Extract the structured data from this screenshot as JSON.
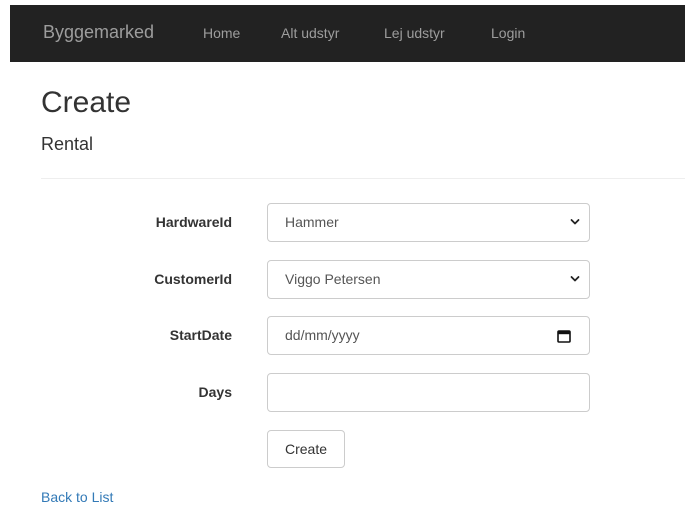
{
  "navbar": {
    "brand": "Byggemarked",
    "links": [
      {
        "label": "Home"
      },
      {
        "label": "Alt udstyr"
      },
      {
        "label": "Lej udstyr"
      },
      {
        "label": "Login"
      }
    ]
  },
  "page": {
    "title": "Create",
    "subtitle": "Rental"
  },
  "form": {
    "hardware": {
      "label": "HardwareId",
      "value": "Hammer"
    },
    "customer": {
      "label": "CustomerId",
      "value": "Viggo Petersen"
    },
    "start_date": {
      "label": "StartDate",
      "placeholder": "dd/mm/yyyy"
    },
    "days": {
      "label": "Days",
      "value": ""
    },
    "submit_label": "Create"
  },
  "back_link": "Back to List",
  "icons": {
    "dropdown": "chevron-down-icon",
    "date": "calendar-icon"
  },
  "colors": {
    "navbar_bg": "#222222",
    "nav_text": "#9d9d9d",
    "link": "#337ab7",
    "border": "#cccccc"
  }
}
